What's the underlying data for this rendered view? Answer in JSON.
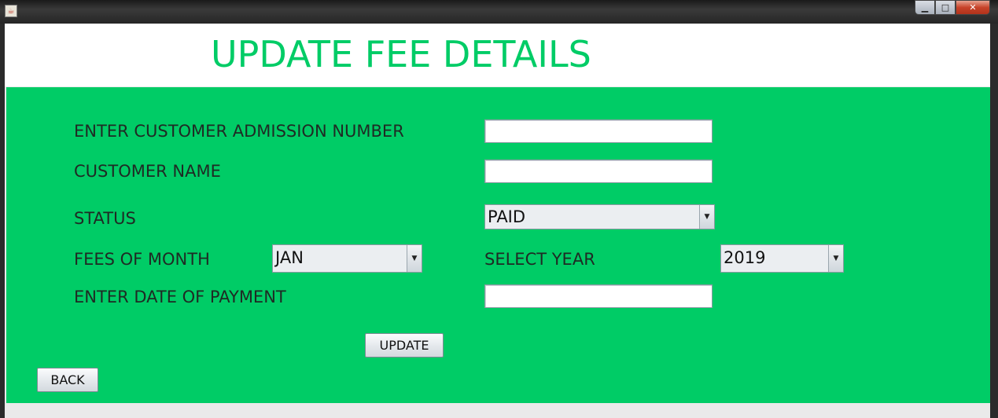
{
  "window": {
    "icon": "java-app-icon",
    "controls": {
      "minimize": "▁",
      "maximize": "□",
      "close": "✕"
    }
  },
  "header": {
    "title": "UPDATE FEE DETAILS"
  },
  "form": {
    "admission_label": "ENTER CUSTOMER ADMISSION NUMBER",
    "admission_value": "",
    "name_label": "CUSTOMER NAME",
    "name_value": "",
    "status_label": "STATUS",
    "status_value": "PAID",
    "month_label": "FEES OF MONTH",
    "month_value": "JAN",
    "year_label": "SELECT YEAR",
    "year_value": "2019",
    "date_label": "ENTER DATE OF PAYMENT",
    "date_value": ""
  },
  "buttons": {
    "update": "UPDATE",
    "back": "BACK"
  },
  "colors": {
    "accent": "#00cc66",
    "header_bg": "#ffffff"
  }
}
